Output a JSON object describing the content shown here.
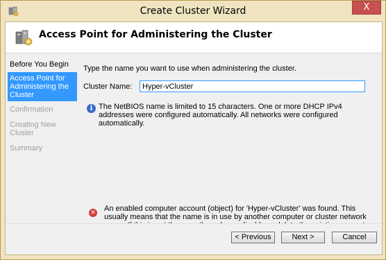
{
  "window": {
    "title": "Create Cluster Wizard",
    "close_glyph": "X",
    "icon": "cluster-wizard-icon"
  },
  "header": {
    "title": "Access Point for Administering the Cluster",
    "icon": "cluster-server-icon"
  },
  "steps": [
    {
      "label": "Before You Begin",
      "state": "done"
    },
    {
      "label": "Access Point for Administering the Cluster",
      "state": "current"
    },
    {
      "label": "Confirmation",
      "state": "pending"
    },
    {
      "label": "Creating New Cluster",
      "state": "pending"
    },
    {
      "label": "Summary",
      "state": "pending"
    }
  ],
  "content": {
    "instruction": "Type the name you want to use when administering the cluster.",
    "cluster_name_label": "Cluster Name:",
    "cluster_name_value": "Hyper-vCluster",
    "info_message": "The NetBIOS name is limited to 15 characters.  One or more DHCP IPv4 addresses were configured automatically.  All networks were configured automatically.",
    "error_message": "An enabled computer account (object) for 'Hyper-vCluster' was found.  This usually means that the name is in use by another computer or cluster network name.  If this is not the case then please disable or delete the existing computer account in Active Directory."
  },
  "buttons": {
    "previous": "< Previous",
    "next": "Next >",
    "cancel": "Cancel"
  },
  "colors": {
    "accent": "#3399ff",
    "title_bar": "#f0e4c0",
    "close": "#c75050",
    "error": "#d33b3b",
    "info": "#3a6cc7"
  }
}
